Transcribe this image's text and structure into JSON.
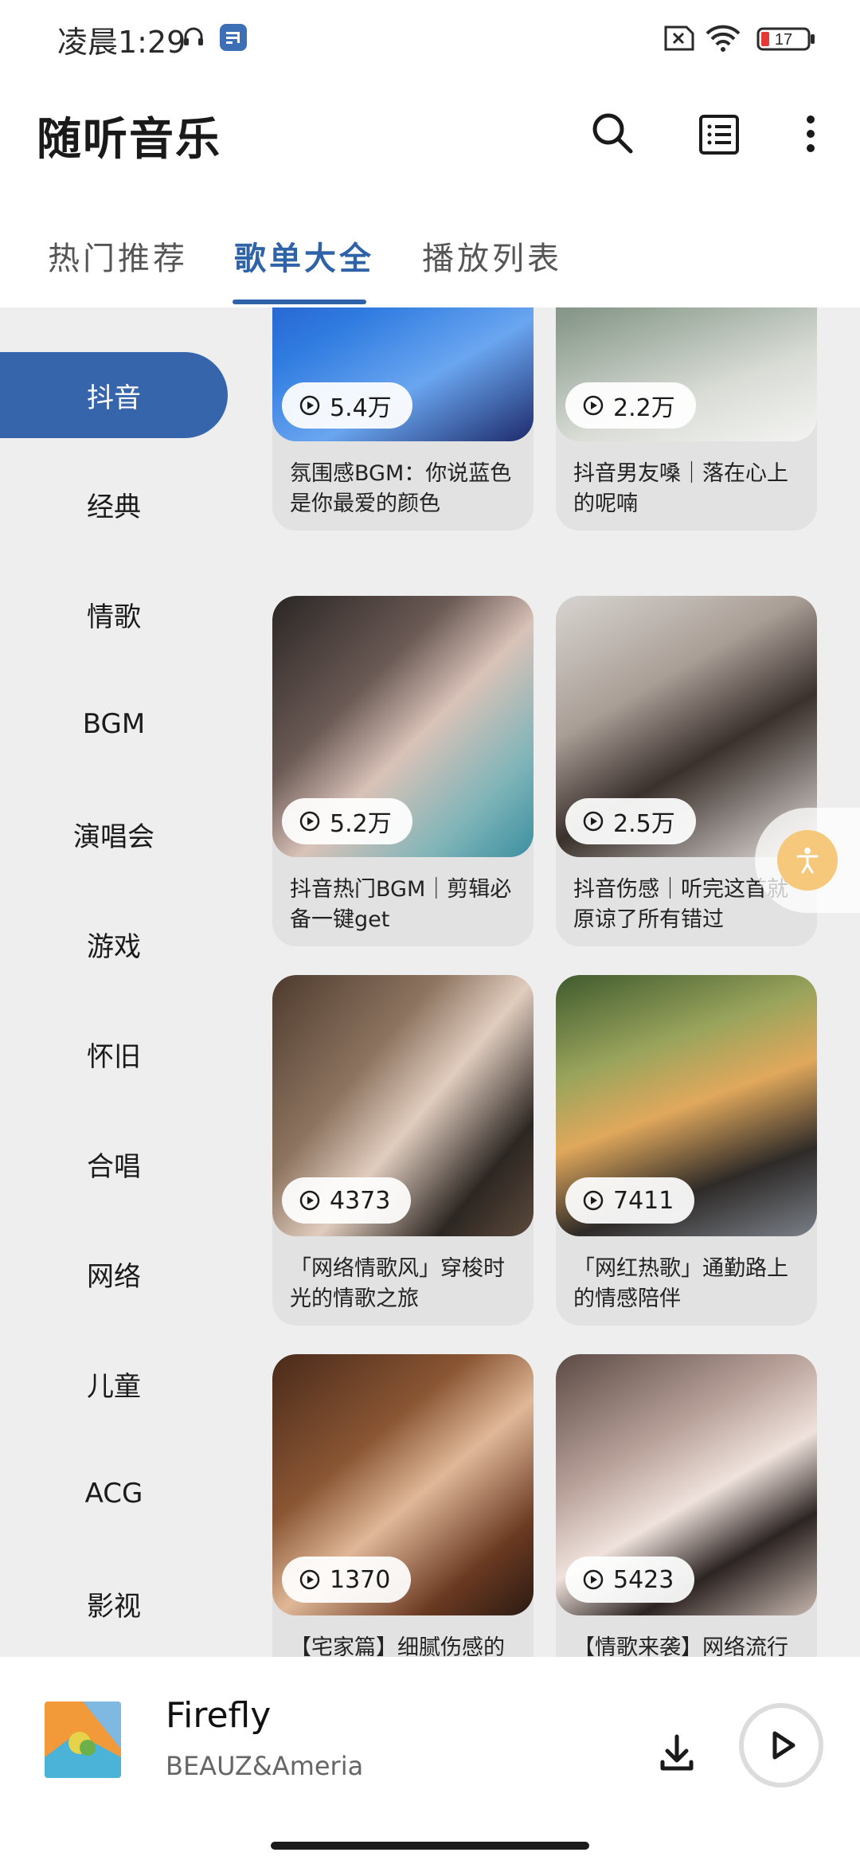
{
  "status_bar": {
    "time": "凌晨1:29",
    "battery": "17",
    "icons": [
      "headset-icon",
      "music-app-icon",
      "sim-off-icon",
      "wifi-icon",
      "battery-icon"
    ]
  },
  "header": {
    "title": "随听音乐",
    "buttons": [
      "search-icon",
      "list-icon",
      "more-vert-icon"
    ]
  },
  "tabs": [
    {
      "label": "热门推荐",
      "active": false
    },
    {
      "label": "歌单大全",
      "active": true
    },
    {
      "label": "播放列表",
      "active": false
    }
  ],
  "sidebar": {
    "items": [
      {
        "label": "抖音",
        "active": true
      },
      {
        "label": "经典"
      },
      {
        "label": "情歌"
      },
      {
        "label": "BGM"
      },
      {
        "label": "演唱会"
      },
      {
        "label": "游戏"
      },
      {
        "label": "怀旧"
      },
      {
        "label": "合唱"
      },
      {
        "label": "网络"
      },
      {
        "label": "儿童"
      },
      {
        "label": "ACG"
      },
      {
        "label": "影视"
      }
    ]
  },
  "playlists": [
    {
      "plays": "5.4万",
      "title": "氛围感BGM：你说蓝色是你最爱的颜色"
    },
    {
      "plays": "2.2万",
      "title": "抖音男友嗓｜落在心上的呢喃"
    },
    {
      "plays": "5.2万",
      "title": "抖音热门BGM｜剪辑必备一键get"
    },
    {
      "plays": "2.5万",
      "title": "抖音伤感｜听完这首就原谅了所有错过"
    },
    {
      "plays": "4373",
      "title": "「网络情歌风」穿梭时光的情歌之旅"
    },
    {
      "plays": "7411",
      "title": "「网红热歌」通勤路上的情感陪伴"
    },
    {
      "plays": "1370",
      "title": "【宅家篇】细腻伤感的"
    },
    {
      "plays": "5423",
      "title": "【情歌来袭】网络流行"
    }
  ],
  "player": {
    "song": "Firefly",
    "artist": "BEAUZ&Ameria"
  },
  "colors": {
    "accent": "#3765ab",
    "float_button": "#f6c87b"
  }
}
